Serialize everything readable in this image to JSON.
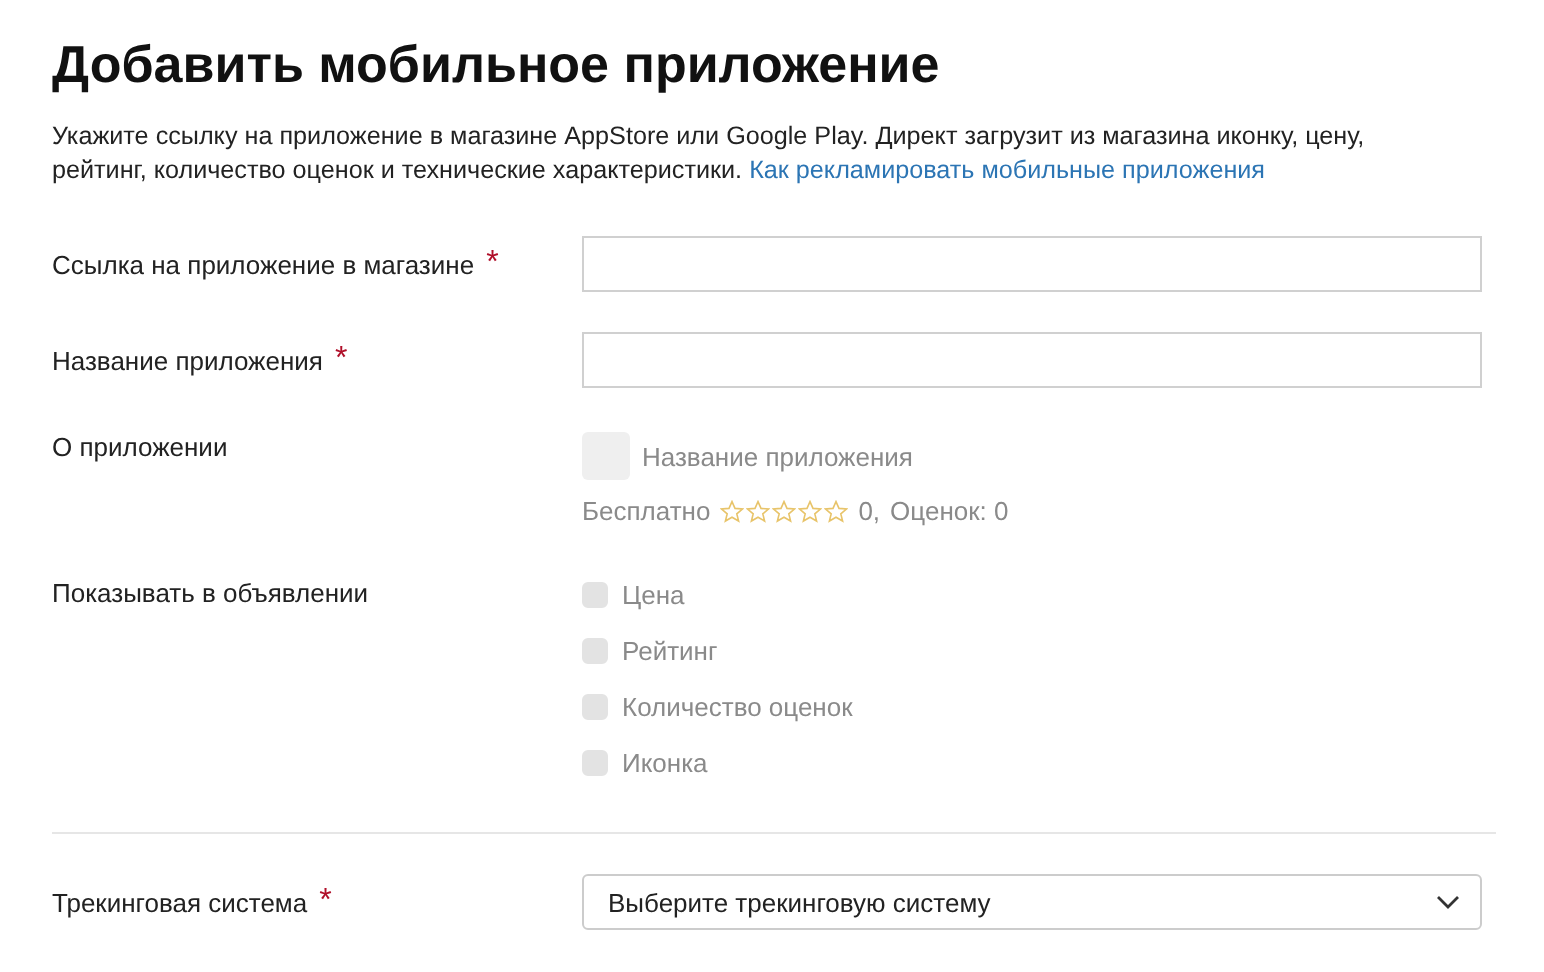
{
  "title": "Добавить мобильное приложение",
  "description": {
    "text": "Укажите ссылку на приложение в магазине AppStore или Google Play. Директ загрузит из магазина иконку, цену, рейтинг, количество оценок и технические характеристики.",
    "link": "Как рекламировать мобильные приложения"
  },
  "fields": [
    {
      "label": "Ссылка на приложение в магазине",
      "required_mark": "*"
    },
    {
      "label": "Название приложения",
      "required_mark": "*"
    }
  ],
  "about": {
    "label": "О приложении",
    "app_name": "Название приложения",
    "price": "Бесплатно",
    "stars": 0,
    "rating": "0,",
    "ratings_count": "Оценок: 0"
  },
  "show_in_ad": {
    "label": "Показывать в объявлении",
    "options": [
      {
        "label": "Цена",
        "checked": false,
        "disabled": true
      },
      {
        "label": "Рейтинг",
        "checked": false,
        "disabled": true
      },
      {
        "label": "Количество оценок",
        "checked": false,
        "disabled": true
      },
      {
        "label": "Иконка",
        "checked": false,
        "disabled": true
      }
    ]
  },
  "tracking": {
    "label": "Трекинговая система",
    "required_mark": "*",
    "placeholder": "Выберите трекинговую систему"
  }
}
